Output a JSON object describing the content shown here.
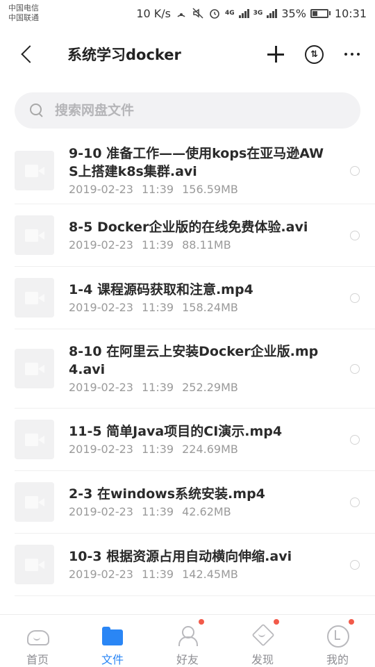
{
  "status_bar": {
    "carrier1": "中国电信",
    "carrier2": "中国联通",
    "speed": "10 K/s",
    "battery_text": "35%",
    "battery_level": 0.35,
    "time": "10:31",
    "net1": "4G",
    "net2": "3G"
  },
  "header": {
    "title": "系统学习docker",
    "sort_icon_glyph": "⇅"
  },
  "search": {
    "placeholder": "搜索网盘文件",
    "value": ""
  },
  "files": [
    {
      "name": "9-10 准备工作——使用kops在亚马逊AWS上搭建k8s集群.avi",
      "date": "2019-02-23",
      "time": "11:39",
      "size": "156.59MB"
    },
    {
      "name": "8-5 Docker企业版的在线免费体验.avi",
      "date": "2019-02-23",
      "time": "11:39",
      "size": "88.11MB"
    },
    {
      "name": "1-4 课程源码获取和注意.mp4",
      "date": "2019-02-23",
      "time": "11:39",
      "size": "158.24MB"
    },
    {
      "name": "8-10 在阿里云上安装Docker企业版.mp4.avi",
      "date": "2019-02-23",
      "time": "11:39",
      "size": "252.29MB"
    },
    {
      "name": "11-5 简单Java项目的CI演示.mp4",
      "date": "2019-02-23",
      "time": "11:39",
      "size": "224.69MB"
    },
    {
      "name": "2-3 在windows系统安装.mp4",
      "date": "2019-02-23",
      "time": "11:39",
      "size": "42.62MB"
    },
    {
      "name": "10-3 根据资源占用自动横向伸缩.avi",
      "date": "2019-02-23",
      "time": "11:39",
      "size": "142.45MB"
    }
  ],
  "bottom_nav": {
    "home": "首页",
    "files": "文件",
    "friends": "好友",
    "discover": "发现",
    "mine": "我的",
    "active": "files"
  },
  "colors": {
    "accent": "#2a86f5",
    "badge": "#f25a4a"
  }
}
